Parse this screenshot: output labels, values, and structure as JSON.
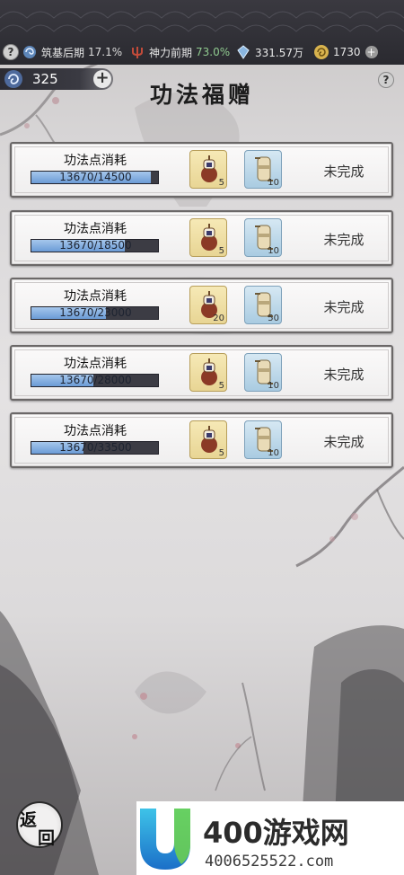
{
  "topbar": {
    "cultivation_label": "筑基后期",
    "cultivation_pct": "17.1%",
    "divine_label": "神力前期",
    "divine_pct": "73.0%",
    "spirit_stones": "331.57万",
    "currency": "1730",
    "help_glyph": "?",
    "plus_glyph": "+"
  },
  "points": {
    "value": "325",
    "plus_glyph": "+"
  },
  "page": {
    "title": "功法福赠",
    "help_glyph": "?"
  },
  "tasks": [
    {
      "label": "功法点消耗",
      "progress_text": "13670/14500",
      "progress": 0.94,
      "reward1_count": "5",
      "reward2_count": "10",
      "status": "未完成"
    },
    {
      "label": "功法点消耗",
      "progress_text": "13670/18500",
      "progress": 0.74,
      "reward1_count": "5",
      "reward2_count": "10",
      "status": "未完成"
    },
    {
      "label": "功法点消耗",
      "progress_text": "13670/23000",
      "progress": 0.59,
      "reward1_count": "20",
      "reward2_count": "50",
      "status": "未完成"
    },
    {
      "label": "功法点消耗",
      "progress_text": "13670/28000",
      "progress": 0.49,
      "reward1_count": "5",
      "reward2_count": "10",
      "status": "未完成"
    },
    {
      "label": "功法点消耗",
      "progress_text": "13670/33500",
      "progress": 0.41,
      "reward1_count": "5",
      "reward2_count": "10",
      "status": "未完成"
    }
  ],
  "back_button": {
    "char1": "返",
    "char2": "回"
  },
  "watermark": {
    "brand": "400游戏网",
    "phone": "4006525522.com"
  },
  "colors": {
    "topbar": "#2a2a30",
    "bar_fill": "#6b9bd6",
    "reward_gold": "#e8d594",
    "reward_blue": "#a9cbe1"
  }
}
